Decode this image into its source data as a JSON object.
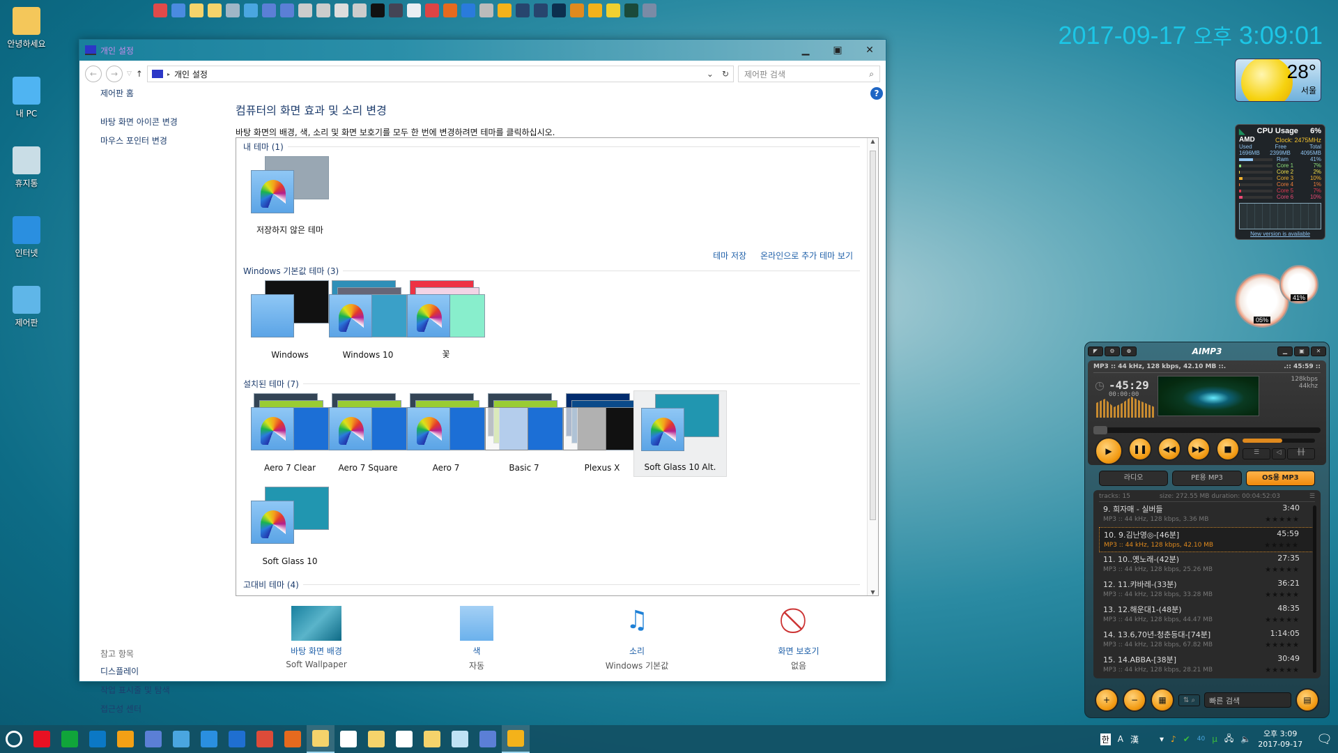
{
  "desktop": {
    "icons": [
      {
        "label": "안녕하세요",
        "icon": "user-folder-icon",
        "color": "#f4c75a"
      },
      {
        "label": "내 PC",
        "icon": "computer-icon",
        "color": "#4fb4f2"
      },
      {
        "label": "휴지통",
        "icon": "recycle-bin-icon",
        "color": "#c9dde6"
      },
      {
        "label": "인터넷",
        "icon": "internet-explorer-icon",
        "color": "#2a8fe0"
      },
      {
        "label": "제어판",
        "icon": "control-panel-icon",
        "color": "#5fb6e8"
      }
    ]
  },
  "clock_widget": {
    "date": "2017-09-17",
    "ampm": "오후",
    "time": "3:09:01"
  },
  "weather": {
    "temp": "28°",
    "city": "서울"
  },
  "cpu_gadget": {
    "title": "CPU Usage",
    "total": "6%",
    "brand": "AMD",
    "clock": "Clock: 2475MHz",
    "mem_headers": [
      "Used",
      "Free",
      "Total"
    ],
    "mem_values": [
      "1696MB",
      "2399MB",
      "4095MB"
    ],
    "rows": [
      {
        "name": "Ram",
        "value": "41%",
        "fraction": 0.41,
        "color": "#8fc3f0"
      },
      {
        "name": "Core 1",
        "value": "7%",
        "fraction": 0.07,
        "color": "#8ee07a"
      },
      {
        "name": "Core 2",
        "value": "2%",
        "fraction": 0.02,
        "color": "#f2e04a"
      },
      {
        "name": "Core 3",
        "value": "10%",
        "fraction": 0.1,
        "color": "#f2b12e"
      },
      {
        "name": "Core 4",
        "value": "1%",
        "fraction": 0.01,
        "color": "#f07e3a"
      },
      {
        "name": "Core 5",
        "value": "7%",
        "fraction": 0.07,
        "color": "#e23a52"
      },
      {
        "name": "Core 6",
        "value": "10%",
        "fraction": 0.1,
        "color": "#e84a74"
      }
    ],
    "link": "New version is available"
  },
  "gauges": {
    "cpu": "05%",
    "ram": "41%"
  },
  "window": {
    "title": "개인 설정",
    "breadcrumb": "개인 설정",
    "search_placeholder": "제어판 검색",
    "left_links": [
      "제어판 홈",
      "바탕 화면 아이콘 변경",
      "마우스 포인터 변경"
    ],
    "see_also": {
      "caption": "참고 항목",
      "links": [
        "디스플레이",
        "작업 표시줄 및 탐색",
        "접근성 센터"
      ]
    },
    "heading": "컴퓨터의 화면 효과 및 소리 변경",
    "description": "바탕 화면의 배경, 색, 소리 및 화면 보호기를 모두 한 번에 변경하려면 테마를 클릭하십시오.",
    "actions": [
      "테마 저장",
      "온라인으로 추가 테마 보기"
    ],
    "sections": [
      {
        "title": "내 테마 (1)",
        "themes": [
          "저장하지 않은 테마"
        ]
      },
      {
        "title": "Windows 기본값 테마 (3)",
        "themes": [
          "Windows",
          "Windows 10",
          "꽃"
        ]
      },
      {
        "title": "설치된 테마 (7)",
        "themes": [
          "Aero 7 Clear",
          "Aero 7 Square",
          "Aero 7",
          "Basic 7",
          "Plexus X",
          "Soft Glass 10  Alt.",
          "Soft Glass 10"
        ],
        "selected": "Soft Glass 10  Alt."
      },
      {
        "title": "고대비 테마 (4)",
        "themes": []
      }
    ],
    "bottom": [
      {
        "label": "바탕 화면 배경",
        "value": "Soft Wallpaper",
        "icon": "wallpaper-icon"
      },
      {
        "label": "색",
        "value": "자동",
        "icon": "color-icon"
      },
      {
        "label": "소리",
        "value": "Windows 기본값",
        "icon": "sound-icon"
      },
      {
        "label": "화면 보호기",
        "value": "없음",
        "icon": "screensaver-icon"
      }
    ]
  },
  "aimp": {
    "title": "AIMP3",
    "info": "MP3 :: 44 kHz, 128 kbps, 42.10 MB ::.",
    "info_right": ".:: 45:59 ::",
    "time": "-45:29",
    "time2": "00:00:00",
    "bitrate": "128kbps",
    "freq": "44khz",
    "seek_fraction": 0.0,
    "volume_fraction": 0.55,
    "tabs": [
      {
        "label": "라디오",
        "active": false
      },
      {
        "label": "PE용  MP3",
        "active": false
      },
      {
        "label": "OS용 MP3",
        "active": true
      }
    ],
    "playlist_header": {
      "tracks": "tracks: 15",
      "summary": "size: 272.55 MB duration: 00:04:52:03"
    },
    "tracks": [
      {
        "title": "9. 희자매 - 실버들",
        "duration": "3:40",
        "meta": "MP3 :: 44 kHz, 128 kbps, 3.36 MB",
        "current": false
      },
      {
        "title": "10. 9.김난영◎-[46분]",
        "duration": "45:59",
        "meta": "MP3 :: 44 kHz, 128 kbps, 42.10 MB",
        "current": true
      },
      {
        "title": "11. 10..옛노래-(42분)",
        "duration": "27:35",
        "meta": "MP3 :: 44 kHz, 128 kbps, 25.26 MB",
        "current": false
      },
      {
        "title": "12. 11.캬바레-(33분)",
        "duration": "36:21",
        "meta": "MP3 :: 44 kHz, 128 kbps, 33.28 MB",
        "current": false
      },
      {
        "title": "13. 12.해운대1-(48분)",
        "duration": "48:35",
        "meta": "MP3 :: 44 kHz, 128 kbps, 44.47 MB",
        "current": false
      },
      {
        "title": "14. 13.6,70년-청춘등대-[74분]",
        "duration": "1:14:05",
        "meta": "MP3 :: 44 kHz, 128 kbps, 67.82 MB",
        "current": false
      },
      {
        "title": "15. 14.ABBA-[38분]",
        "duration": "30:49",
        "meta": "MP3 :: 44 kHz, 128 kbps, 28.21 MB",
        "current": false
      }
    ],
    "stars": "★★★★★",
    "quick_search": "빠른 검색"
  },
  "taskbar": {
    "items": [
      {
        "name": "cortana-icon",
        "color": "#ffffff"
      },
      {
        "name": "power-icon",
        "color": "#e81123"
      },
      {
        "name": "restart-icon",
        "color": "#10a53a"
      },
      {
        "name": "logoff-icon",
        "color": "#0b78c5"
      },
      {
        "name": "shutdown-icon",
        "color": "#f3a015"
      },
      {
        "name": "remote-desktop-icon",
        "color": "#5b7fd6"
      },
      {
        "name": "network-tool-icon",
        "color": "#4aa6e0"
      },
      {
        "name": "internet-explorer-icon",
        "color": "#2a8fe0"
      },
      {
        "name": "edge-icon",
        "color": "#1f6fd1"
      },
      {
        "name": "chrome-icon",
        "color": "#dd4b39"
      },
      {
        "name": "firefox-icon",
        "color": "#e66a1e"
      },
      {
        "name": "file-explorer-icon",
        "color": "#f5d36b",
        "active": true
      },
      {
        "name": "store-icon",
        "color": "#ffffff"
      },
      {
        "name": "file-explorer-icon",
        "color": "#f5d36b"
      },
      {
        "name": "mail-icon",
        "color": "#ffffff"
      },
      {
        "name": "file-explorer-icon",
        "color": "#f5d36b"
      },
      {
        "name": "notepad-icon",
        "color": "#bfe2f4"
      },
      {
        "name": "remote-desktop-icon",
        "color": "#5b7fd6"
      },
      {
        "name": "aimp-icon",
        "color": "#f4b21a",
        "active": true
      }
    ],
    "ime": [
      "한",
      "A",
      "漢"
    ],
    "tray_time": "오후 3:09",
    "tray_date": "2017-09-17",
    "signal": "40"
  }
}
